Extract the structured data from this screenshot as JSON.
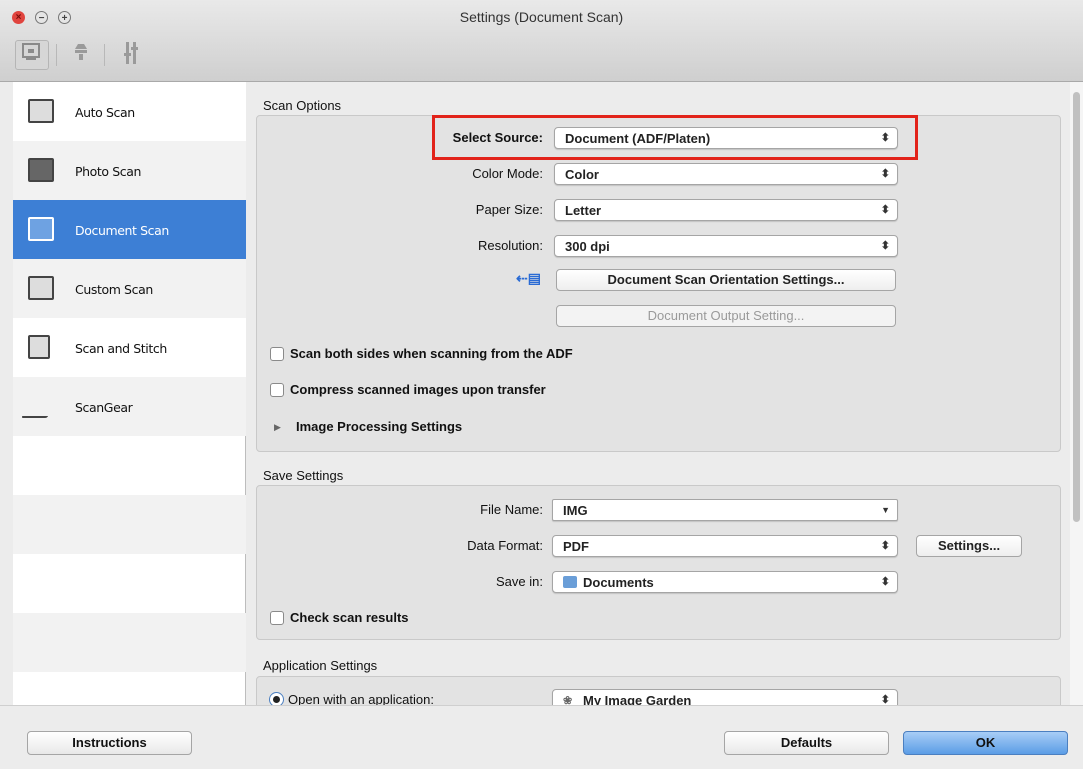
{
  "window": {
    "title": "Settings (Document Scan)"
  },
  "toolbar": {
    "icons": [
      "document-scan-icon",
      "scanner-icon",
      "general-settings-icon"
    ]
  },
  "sidebar": {
    "items": [
      {
        "label": "Auto Scan",
        "icon": "auto-scan-icon"
      },
      {
        "label": "Photo Scan",
        "icon": "photo-scan-icon"
      },
      {
        "label": "Document Scan",
        "icon": "document-scan-icon",
        "selected": true
      },
      {
        "label": "Custom Scan",
        "icon": "custom-scan-icon"
      },
      {
        "label": "Scan and Stitch",
        "icon": "scan-stitch-icon"
      },
      {
        "label": "ScanGear",
        "icon": "scangear-icon"
      }
    ]
  },
  "scan_options": {
    "title": "Scan Options",
    "select_source": {
      "label": "Select Source:",
      "value": "Document (ADF/Platen)"
    },
    "color_mode": {
      "label": "Color Mode:",
      "value": "Color"
    },
    "paper_size": {
      "label": "Paper Size:",
      "value": "Letter"
    },
    "resolution": {
      "label": "Resolution:",
      "value": "300 dpi"
    },
    "orientation_button": "Document Scan Orientation Settings...",
    "output_button": "Document Output Setting...",
    "scan_both_sides": "Scan both sides when scanning from the ADF",
    "compress": "Compress scanned images upon transfer",
    "image_processing": "Image Processing Settings"
  },
  "save_settings": {
    "title": "Save Settings",
    "file_name": {
      "label": "File Name:",
      "value": "IMG"
    },
    "data_format": {
      "label": "Data Format:",
      "value": "PDF"
    },
    "settings_button": "Settings...",
    "save_in": {
      "label": "Save in:",
      "value": "Documents"
    },
    "check_results": "Check scan results"
  },
  "application_settings": {
    "title": "Application Settings",
    "open_with": "Open with an application:",
    "app_value": "My Image Garden"
  },
  "bottom": {
    "instructions": "Instructions",
    "defaults": "Defaults",
    "ok": "OK"
  },
  "colors": {
    "selection": "#3d7fd5",
    "highlight": "#e2231a"
  }
}
